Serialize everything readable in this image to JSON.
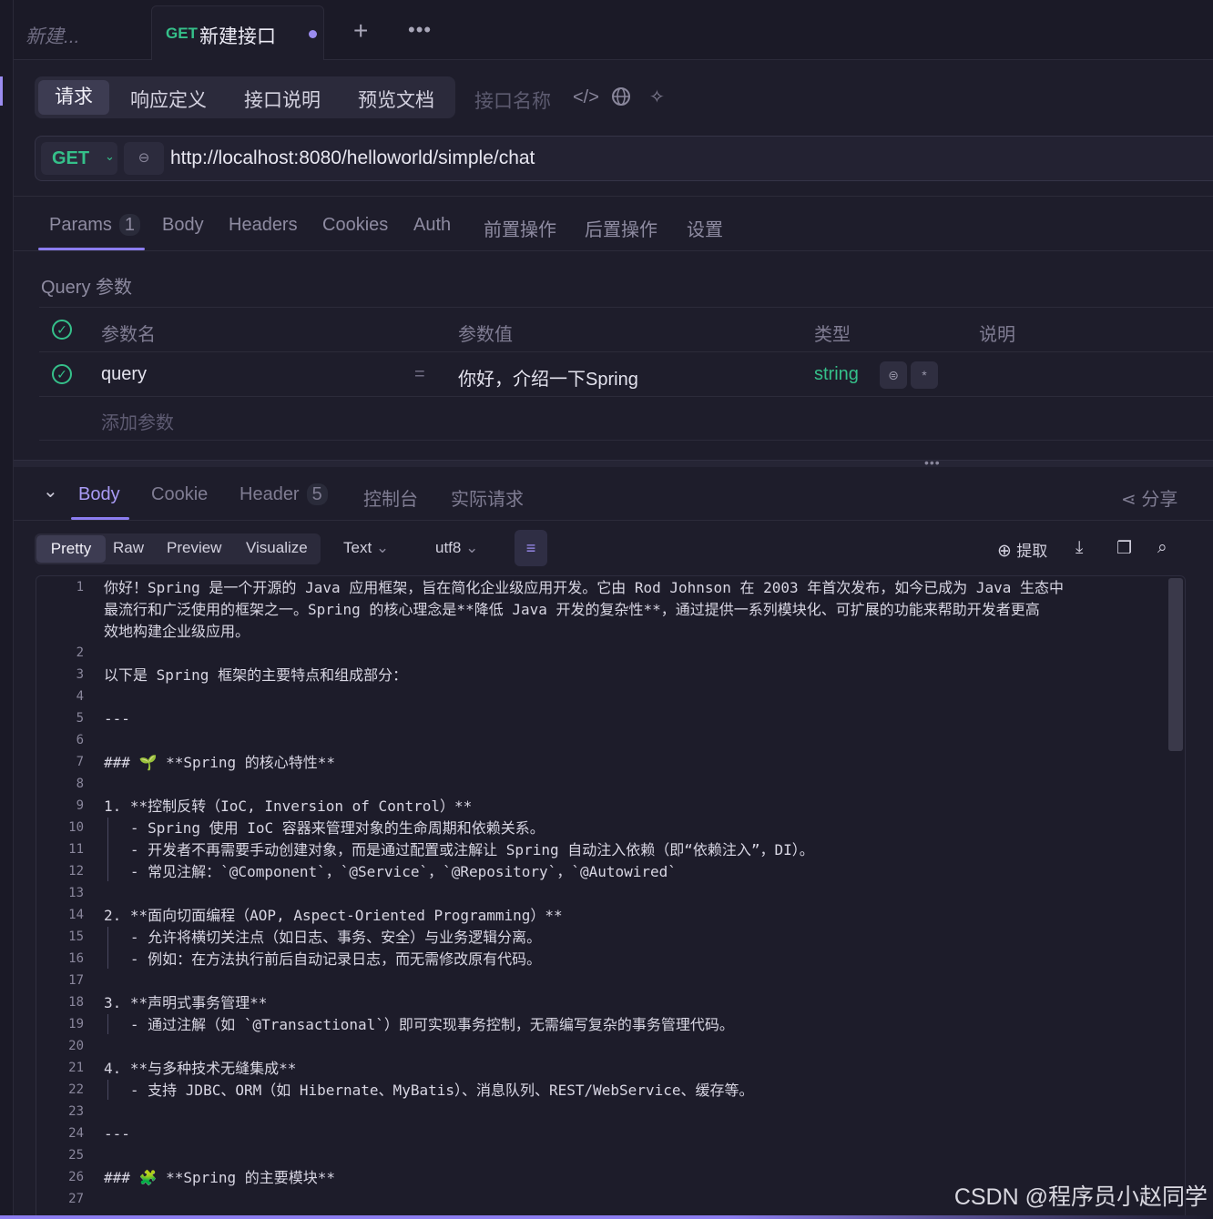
{
  "tabs": [
    {
      "label": "新建..."
    },
    {
      "method": "GET",
      "label": "新建接口"
    }
  ],
  "request_tabs": [
    "请求",
    "响应定义",
    "接口说明",
    "预览文档"
  ],
  "interface_name_placeholder": "接口名称",
  "method": "GET",
  "url": "http://localhost:8080/helloworld/simple/chat",
  "param_tabs": {
    "params": "Params",
    "params_count": "1",
    "body": "Body",
    "headers": "Headers",
    "cookies": "Cookies",
    "auth": "Auth",
    "pre": "前置操作",
    "post": "后置操作",
    "settings": "设置"
  },
  "query_title": "Query 参数",
  "query_headers": {
    "name": "参数名",
    "value": "参数值",
    "type": "类型",
    "desc": "说明"
  },
  "query_row": {
    "name": "query",
    "eq": "=",
    "value": "你好，介绍一下Spring",
    "type": "string",
    "required": "*"
  },
  "add_param": "添加参数",
  "response_tabs": {
    "body": "Body",
    "cookie": "Cookie",
    "header": "Header",
    "header_count": "5",
    "console": "控制台",
    "actual": "实际请求",
    "share": "分享"
  },
  "view_modes": [
    "Pretty",
    "Raw",
    "Preview",
    "Visualize"
  ],
  "format": "Text",
  "encoding": "utf8",
  "extract": "提取",
  "code_lines": [
    {
      "n": "1",
      "t": "你好！Spring 是一个开源的 Java 应用框架，旨在简化企业级应用开发。它由 Rod Johnson 在 2003 年首次发布，如今已成为 Java 生态中"
    },
    {
      "n": "",
      "t": "最流行和广泛使用的框架之一。Spring 的核心理念是**降低 Java 开发的复杂性**，通过提供一系列模块化、可扩展的功能来帮助开发者更高"
    },
    {
      "n": "",
      "t": "效地构建企业级应用。"
    },
    {
      "n": "2",
      "t": ""
    },
    {
      "n": "3",
      "t": "以下是 Spring 框架的主要特点和组成部分："
    },
    {
      "n": "4",
      "t": ""
    },
    {
      "n": "5",
      "t": "---"
    },
    {
      "n": "6",
      "t": ""
    },
    {
      "n": "7",
      "t": "### 🌱 **Spring 的核心特性**"
    },
    {
      "n": "8",
      "t": ""
    },
    {
      "n": "9",
      "t": "1. **控制反转（IoC, Inversion of Control）**"
    },
    {
      "n": "10",
      "t": "   - Spring 使用 IoC 容器来管理对象的生命周期和依赖关系。"
    },
    {
      "n": "11",
      "t": "   - 开发者不再需要手动创建对象，而是通过配置或注解让 Spring 自动注入依赖（即“依赖注入”，DI）。"
    },
    {
      "n": "12",
      "t": "   - 常见注解：`@Component`，`@Service`，`@Repository`，`@Autowired`"
    },
    {
      "n": "13",
      "t": ""
    },
    {
      "n": "14",
      "t": "2. **面向切面编程（AOP, Aspect-Oriented Programming）**"
    },
    {
      "n": "15",
      "t": "   - 允许将横切关注点（如日志、事务、安全）与业务逻辑分离。"
    },
    {
      "n": "16",
      "t": "   - 例如：在方法执行前后自动记录日志，而无需修改原有代码。"
    },
    {
      "n": "17",
      "t": ""
    },
    {
      "n": "18",
      "t": "3. **声明式事务管理**"
    },
    {
      "n": "19",
      "t": "   - 通过注解（如 `@Transactional`）即可实现事务控制，无需编写复杂的事务管理代码。"
    },
    {
      "n": "20",
      "t": ""
    },
    {
      "n": "21",
      "t": "4. **与多种技术无缝集成**"
    },
    {
      "n": "22",
      "t": "   - 支持 JDBC、ORM（如 Hibernate、MyBatis）、消息队列、REST/WebService、缓存等。"
    },
    {
      "n": "23",
      "t": ""
    },
    {
      "n": "24",
      "t": "---"
    },
    {
      "n": "25",
      "t": ""
    },
    {
      "n": "26",
      "t": "### 🧩 **Spring 的主要模块**"
    },
    {
      "n": "27",
      "t": ""
    }
  ],
  "watermark": "CSDN @程序员小赵同学",
  "colors": {
    "accent": "#8c7df0",
    "green": "#35c08a",
    "background": "#1e1d2b"
  }
}
